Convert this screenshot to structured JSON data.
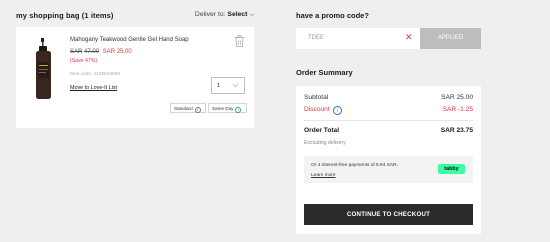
{
  "bag": {
    "title": "my shopping bag (1 items)",
    "deliver_label": "Deliver to:",
    "deliver_value": "Select"
  },
  "item": {
    "name": "Mahogany Teakwood Gentle Gel Hand Soap",
    "currency": "SAR",
    "original_price": "47.00",
    "sale_price": "SAR 25.00",
    "save_text": "(Save 47%)",
    "item_code": "Item code: 1102642556",
    "love_link": "Move to Love-It List",
    "quantity": "1",
    "shipping_standard": "Standard",
    "shipping_sameday": "Same Day"
  },
  "promo": {
    "title": "have a promo code?",
    "code": "TDEE",
    "applied_label": "APPLIED"
  },
  "summary": {
    "title": "Order Summary",
    "subtotal_label": "Subtotal",
    "subtotal_value": "SAR 25.00",
    "discount_label": "Discount",
    "discount_value": "SAR -1.25",
    "total_label": "Order Total",
    "total_value": "SAR 23.75",
    "excluding": "Excluding delivery",
    "installments_text": "Or 4 interest-free payments of 5.94 SAR.",
    "learn_more": "Learn more",
    "tabby_logo": "tabby",
    "checkout_label": "CONTINUE TO CHECKOUT"
  },
  "colors": {
    "accent_red": "#e0343f",
    "tabby_green": "#3bffa4",
    "checkout_bg": "#2b2b2b"
  }
}
